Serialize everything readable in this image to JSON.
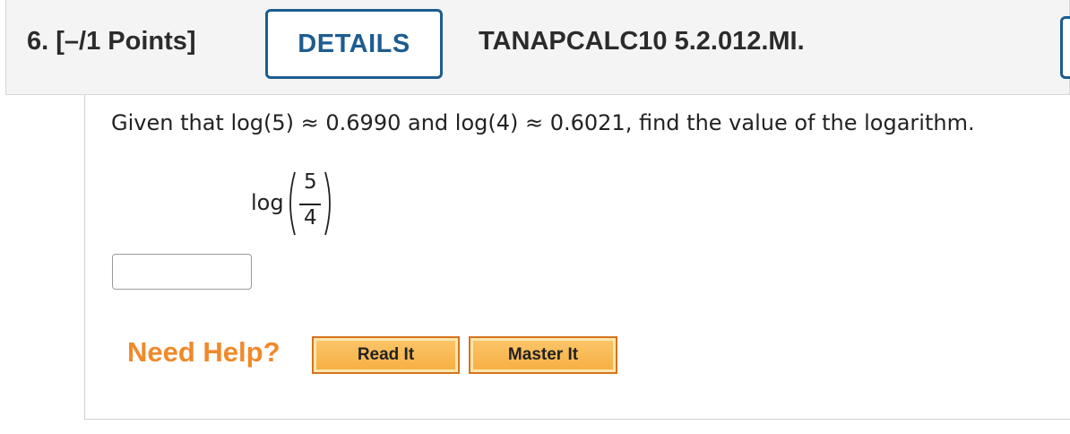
{
  "header": {
    "question_number": "6.",
    "points": "[–/1 Points]",
    "details_label": "DETAILS",
    "question_id": "TANAPCALC10 5.2.012.MI."
  },
  "problem": {
    "prompt": "Given that log(5) ≈ 0.6990 and log(4) ≈ 0.6021, find the value of the logarithm.",
    "expression": {
      "function": "log",
      "numerator": "5",
      "denominator": "4"
    }
  },
  "answer": {
    "value": "",
    "placeholder": ""
  },
  "help": {
    "label": "Need Help?",
    "read_it_label": "Read It",
    "master_it_label": "Master It"
  },
  "colors": {
    "accent": "#1d5c8f",
    "help_orange": "#f0892a",
    "button_fill": "#f6ae3f"
  }
}
